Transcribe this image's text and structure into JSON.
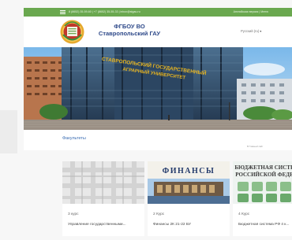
{
  "topbar": {
    "contacts": "8 (8652) 35-59-60 | +7 (8652) 35-55-33 | inbox@stgau.ru",
    "right": "Английская версия | Меню"
  },
  "header": {
    "brand_line1": "ФГБОУ ВО",
    "brand_line2": "Ставропольский ГАУ",
    "language": "Русский (ru)"
  },
  "hero": {
    "building_sign_line1": "СТАВРОПОЛЬСКИЙ ГОСУДАРСТВЕННЫЙ",
    "building_sign_line2": "АГРАРНЫЙ УНИВЕРСИТЕТ"
  },
  "section": {
    "title": "Факультеты",
    "small_link": "В Главный сайт"
  },
  "courses": [
    {
      "year": "3 курс",
      "name": "Управление государственными..."
    },
    {
      "year": "2 Курс",
      "name": "Финансы 2К 21-22 БУ",
      "thumb_title": "ФИНАНСЫ"
    },
    {
      "year": "4 Курс",
      "name": "Бюджетная система РФ 4 к...",
      "thumb_title_line1": "БЮДЖЕТНАЯ СИСТЕ",
      "thumb_title_line2": "РОССИЙСКОЙ ФЕДЕ"
    }
  ],
  "colors": {
    "topbar": "#6aa84f",
    "brand": "#2f4a8a",
    "link": "#3d6fb4"
  }
}
